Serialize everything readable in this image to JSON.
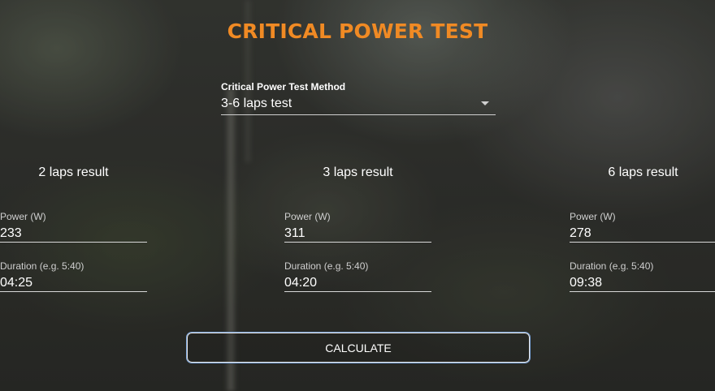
{
  "page": {
    "title": "CRITICAL POWER TEST"
  },
  "method": {
    "label": "Critical Power Test Method",
    "selected": "3-6 laps test",
    "caret_icon": "chevron-down-icon"
  },
  "results": [
    {
      "title": "2 laps result",
      "power_label": "Power (W)",
      "power_value": "233",
      "duration_label": "Duration (e.g. 5:40)",
      "duration_value": "04:25"
    },
    {
      "title": "3 laps result",
      "power_label": "Power (W)",
      "power_value": "311",
      "duration_label": "Duration (e.g. 5:40)",
      "duration_value": "04:20"
    },
    {
      "title": "6 laps result",
      "power_label": "Power (W)",
      "power_value": "278",
      "duration_label": "Duration (e.g. 5:40)",
      "duration_value": "09:38"
    }
  ],
  "actions": {
    "calculate_label": "CALCULATE"
  },
  "colors": {
    "accent": "#f08a24",
    "text": "#ffffff",
    "underline": "#d8d8d8",
    "focus_outline": "#7aa3d8"
  }
}
